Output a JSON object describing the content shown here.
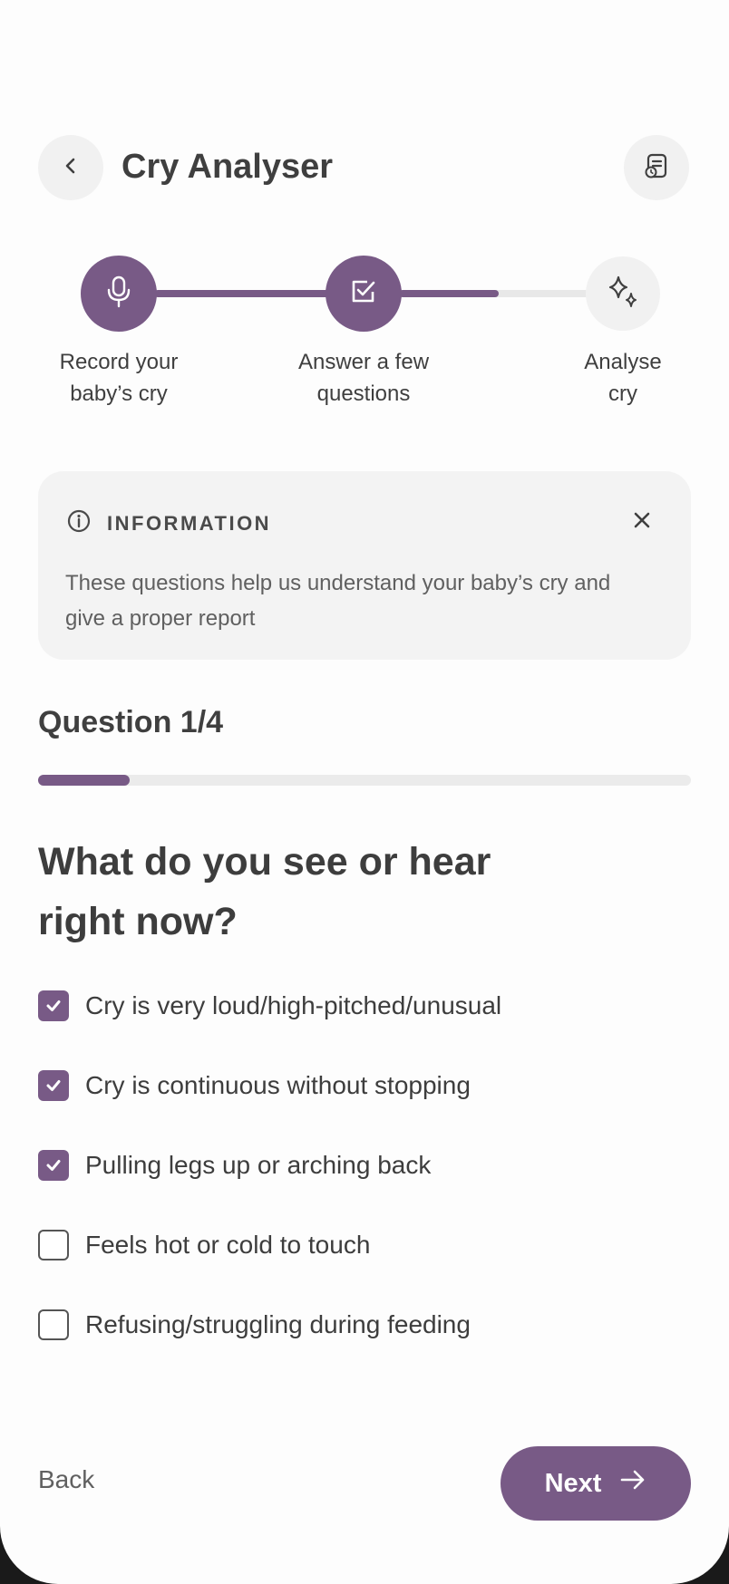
{
  "header": {
    "title": "Cry Analyser",
    "back_icon": "chevron-left-icon",
    "report_icon": "document-clock-icon"
  },
  "stepper": {
    "steps": [
      {
        "label": "Record your\nbaby’s cry",
        "icon": "microphone-icon",
        "state": "complete"
      },
      {
        "label": "Answer a few\nquestions",
        "icon": "checkbox-icon",
        "state": "current"
      },
      {
        "label": "Analyse\ncry",
        "icon": "sparkles-icon",
        "state": "upcoming"
      }
    ],
    "accent": "#785a86"
  },
  "info": {
    "heading": "INFORMATION",
    "text": "These questions help us understand your baby’s cry and give a proper report",
    "icon": "info-circle-icon",
    "close_icon": "close-icon"
  },
  "quiz": {
    "counter": "Question 1/4",
    "progress": 0.14,
    "question": "What do you see or hear right now?",
    "options": [
      {
        "label": "Cry is very loud/high-pitched/unusual",
        "checked": true
      },
      {
        "label": "Cry is continuous without stopping",
        "checked": true
      },
      {
        "label": "Pulling legs up or arching back",
        "checked": true
      },
      {
        "label": "Feels hot or cold to touch",
        "checked": false
      },
      {
        "label": "Refusing/struggling during feeding",
        "checked": false
      }
    ]
  },
  "footer": {
    "back_label": "Back",
    "next_label": "Next",
    "next_icon": "arrow-right-icon"
  }
}
